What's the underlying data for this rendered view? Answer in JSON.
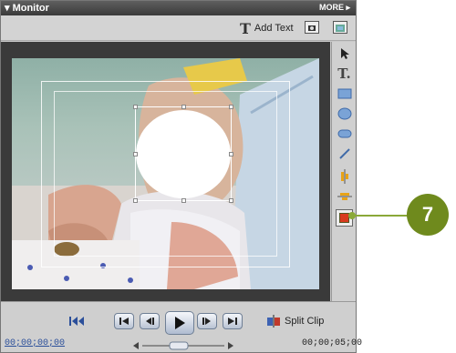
{
  "window": {
    "title": "Monitor",
    "more_label": "MORE"
  },
  "toolbar": {
    "add_text_label": "Add Text"
  },
  "tools": {
    "items": [
      "selection-arrow-icon",
      "text-tool-icon",
      "rectangle-icon",
      "ellipse-icon",
      "rounded-rectangle-icon",
      "line-icon",
      "align-vertical-icon",
      "align-horizontal-icon",
      "color-swatch-icon"
    ],
    "active_index": 8,
    "swatch_color": "#d83a1e"
  },
  "transport": {
    "timecode_start": "00;00;00;00",
    "timecode_end": "00;00;05;00",
    "split_clip_label": "Split Clip"
  },
  "callout": {
    "number": "7",
    "color": "#6f8a1d"
  }
}
